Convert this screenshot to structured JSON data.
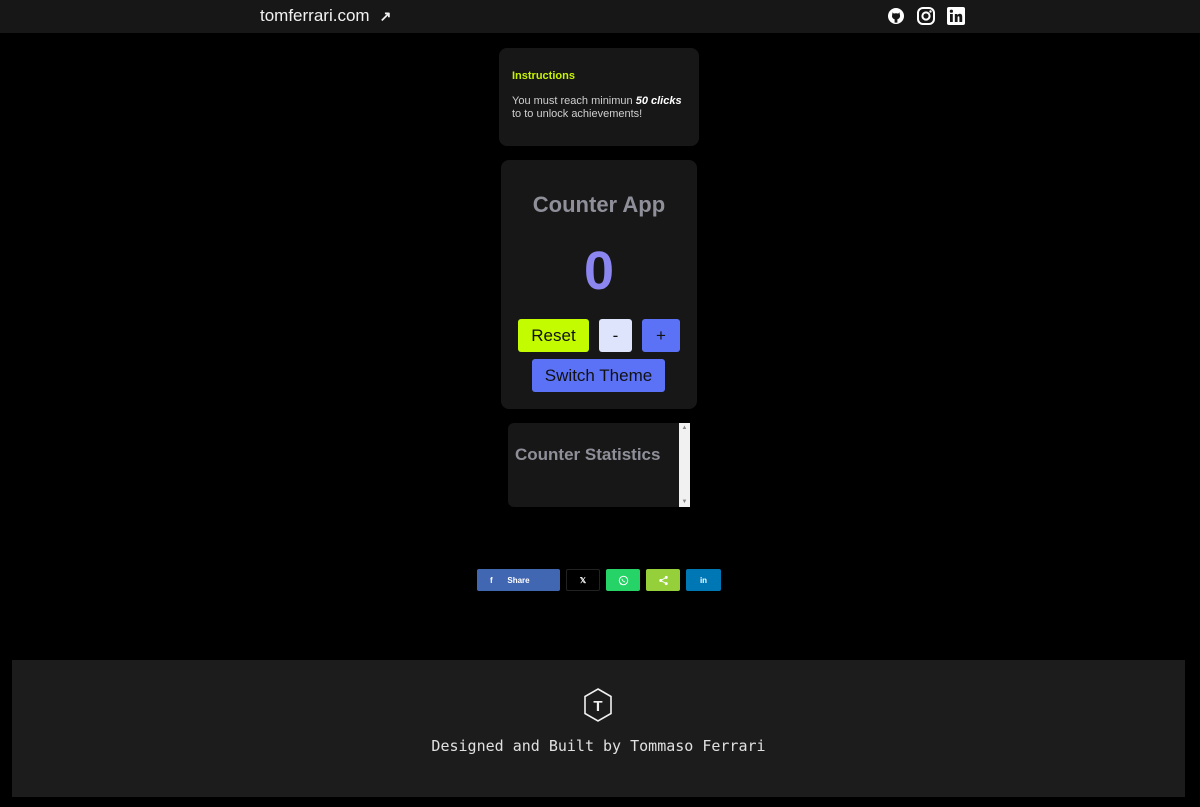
{
  "header": {
    "site_name": "tomferrari.com",
    "site_link_arrow": "↗",
    "social_icons": [
      "github-icon",
      "instagram-icon",
      "linkedin-icon"
    ]
  },
  "instructions": {
    "title": "Instructions",
    "text_prefix": "You must reach minimun ",
    "highlight": "50 clicks",
    "text_suffix": " to to unlock achievements!"
  },
  "counter": {
    "title": "Counter App",
    "value": "0",
    "reset_label": "Reset",
    "minus_label": "-",
    "plus_label": "+",
    "switch_theme_label": "Switch Theme"
  },
  "statistics": {
    "title": "Counter Statistics"
  },
  "share": {
    "facebook_icon": "f",
    "facebook_label": "Share",
    "x_label": "𝕏",
    "linkedin_label": "in"
  },
  "footer": {
    "logo_letter": "T",
    "credit": "Designed and Built by Tommaso Ferrari"
  },
  "colors": {
    "accent_green": "#c3fb00",
    "accent_blue": "#5b72f7",
    "counter_value": "#8c87f0",
    "panel": "#171717"
  }
}
